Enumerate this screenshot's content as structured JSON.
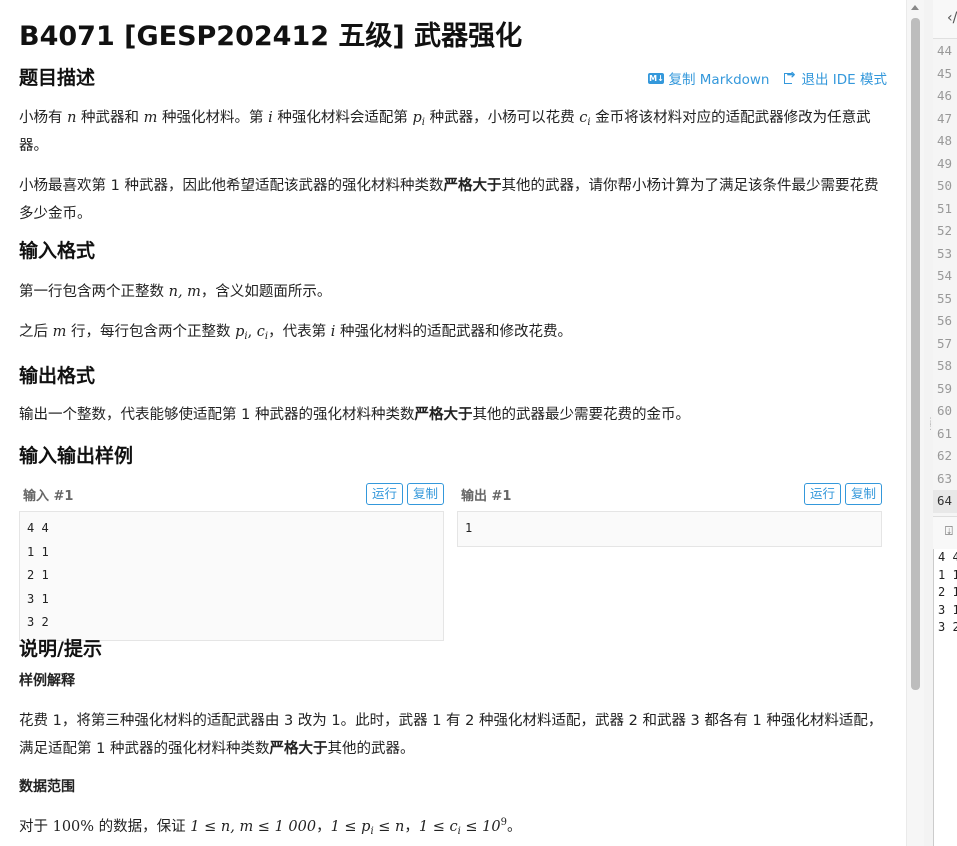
{
  "problem": {
    "title": "B4071 [GESP202412 五级] 武器强化",
    "actions": {
      "copy_md": "复制 Markdown",
      "exit_ide": "退出 IDE 模式"
    },
    "sections": {
      "desc": "题目描述",
      "input": "输入格式",
      "output": "输出格式",
      "samples": "输入输出样例",
      "hint": "说明/提示",
      "sample_explain": "样例解释",
      "data_range": "数据范围"
    },
    "desc1": {
      "t1": "小杨有 ",
      "n": "n",
      "t2": " 种武器和 ",
      "m": "m",
      "t3": " 种强化材料。第 ",
      "i": "i",
      "t4": " 种强化材料会适配第 ",
      "p": "p",
      "pi": "i",
      "t5": " 种武器，小杨可以花费 ",
      "c": "c",
      "ci": "i",
      "t6": " 金币将该材料对应的适配武器修改为任意武器。"
    },
    "desc2": {
      "t1": "小杨最喜欢第 1 种武器，因此他希望适配该武器的强化材料种类数",
      "bold": "严格大于",
      "t2": "其他的武器，请你帮小杨计算为了满足该条件最少需要花费多少金币。"
    },
    "input1": {
      "t1": "第一行包含两个正整数 ",
      "nm": "n, m",
      "t2": "，含义如题面所示。"
    },
    "input2": {
      "t1": "之后 ",
      "m": "m",
      "t2": " 行，每行包含两个正整数 ",
      "p": "p",
      "pi": "i",
      "comma": ", ",
      "c": "c",
      "ci": "i",
      "t3": "，代表第 ",
      "i": "i",
      "t4": " 种强化材料的适配武器和修改花费。"
    },
    "output1": {
      "t1": "输出一个整数，代表能够使适配第 1 种武器的强化材料种类数",
      "bold": "严格大于",
      "t2": "其他的武器最少需要花费的金币。"
    },
    "sample_in": {
      "label": "输入 #1",
      "run": "运行",
      "copy": "复制",
      "content": "4 4\n1 1\n2 1\n3 1\n3 2"
    },
    "sample_out": {
      "label": "输出 #1",
      "run": "运行",
      "copy": "复制",
      "content": "1"
    },
    "explain": {
      "t1": "花费 1，将第三种强化材料的适配武器由 3 改为 1。此时，武器 1 有 2 种强化材料适配，武器 2 和武器 3 都各有 1 种强化材料适配，满足适配第 1 种武器的强化材料种类数",
      "bold": "严格大于",
      "t2": "其他的武器。"
    },
    "range": {
      "t1": "对于 ",
      "pct": "100%",
      "t2": " 的数据，保证 ",
      "e1": "1 ≤ n, m ≤ 1 000",
      "sep1": "，",
      "e2a": "1 ≤ ",
      "p": "p",
      "pi": "i",
      "e2b": " ≤ n",
      "sep2": "，",
      "e3a": "1 ≤ ",
      "c": "c",
      "ci": "i",
      "e3b": " ≤ 10",
      "exp": "9",
      "end": "。"
    }
  },
  "editor": {
    "top_icon": "‹/",
    "line_numbers": [
      "44",
      "45",
      "46",
      "47",
      "48",
      "49",
      "50",
      "51",
      "52",
      "53",
      "54",
      "55",
      "56",
      "57",
      "58",
      "59",
      "60",
      "61",
      "62",
      "63",
      "64"
    ],
    "active_line": "64",
    "io_icon": "⍗",
    "io_lines": [
      "4 4",
      "1 1",
      "2 1",
      "3 1",
      "3 2"
    ]
  }
}
